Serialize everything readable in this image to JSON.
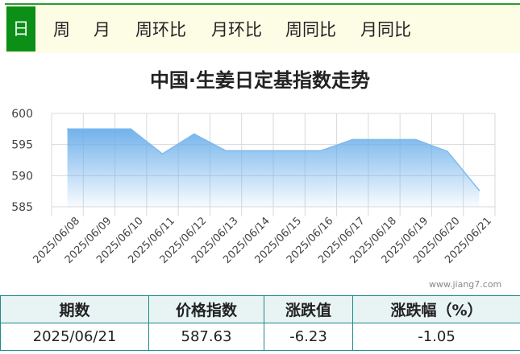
{
  "tabs": [
    {
      "label": "日",
      "active": true
    },
    {
      "label": "周",
      "active": false
    },
    {
      "label": "月",
      "active": false
    },
    {
      "label": "周环比",
      "active": false
    },
    {
      "label": "月环比",
      "active": false
    },
    {
      "label": "周同比",
      "active": false
    },
    {
      "label": "月同比",
      "active": false
    }
  ],
  "watermark": "www.jiang7.com",
  "chart_data": {
    "type": "area",
    "title": "中国·生姜日定基指数走势",
    "xlabel": "",
    "ylabel": "",
    "ylim": [
      585,
      600
    ],
    "yticks": [
      600,
      595,
      590,
      585
    ],
    "grid": true,
    "categories": [
      "2025/06/08",
      "2025/06/09",
      "2025/06/10",
      "2025/06/11",
      "2025/06/12",
      "2025/06/13",
      "2025/06/14",
      "2025/06/15",
      "2025/06/16",
      "2025/06/17",
      "2025/06/18",
      "2025/06/19",
      "2025/06/20",
      "2025/06/21"
    ],
    "series": [
      {
        "values": [
          597.5,
          597.5,
          597.5,
          593.5,
          596.7,
          594.0,
          594.0,
          594.0,
          594.0,
          595.8,
          595.8,
          595.8,
          593.9,
          587.63
        ],
        "color": "#7fb9ee"
      }
    ]
  },
  "summary": {
    "headers": [
      "期数",
      "价格指数",
      "涨跌值",
      "涨跌幅（%）"
    ],
    "row": [
      "2025/06/21",
      "587.63",
      "-6.23",
      "-1.05"
    ]
  },
  "colors": {
    "active_tab": "#0b8f16",
    "tab_bar_bg": "#fdfde6",
    "table_border": "#1f8a8a",
    "area_line": "#7fb9ee"
  }
}
